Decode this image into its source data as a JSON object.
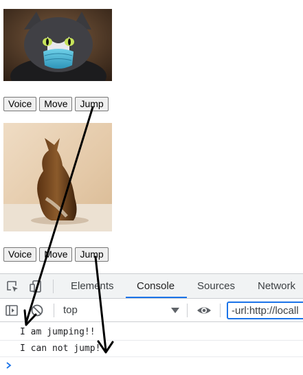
{
  "card1": {
    "buttons": {
      "voice": "Voice",
      "move": "Move",
      "jump": "Jump"
    }
  },
  "card2": {
    "buttons": {
      "voice": "Voice",
      "move": "Move",
      "jump": "Jump"
    }
  },
  "devtools": {
    "tabs": [
      "Elements",
      "Console",
      "Sources",
      "Network"
    ],
    "active_tab": "Console",
    "context": "top",
    "filter_value": "-url:http://locall",
    "console_messages": [
      "I am jumping!!",
      "I can not jump!"
    ],
    "accent_color": "#1a73e8"
  }
}
